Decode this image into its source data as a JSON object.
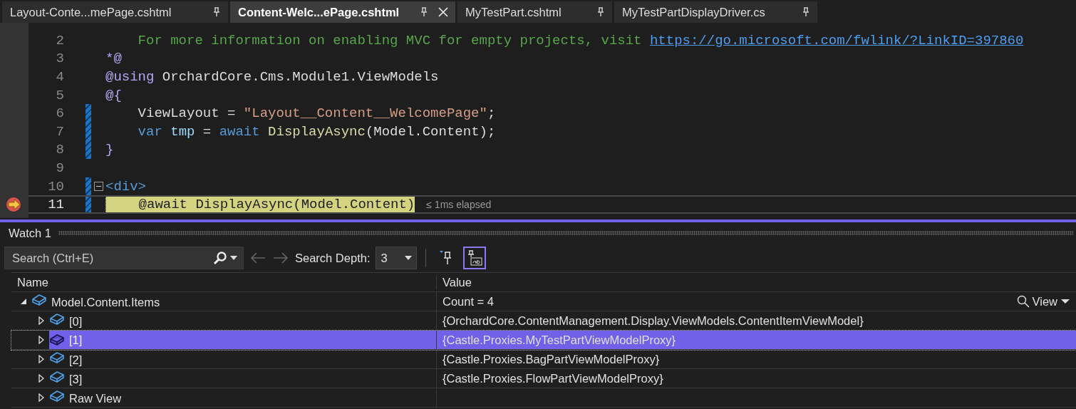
{
  "tabs": [
    {
      "label": "Layout-Conte...mePage.cshtml",
      "selected": false
    },
    {
      "label": "Content-Welc...ePage.cshtml",
      "selected": true
    },
    {
      "label": "MyTestPart.cshtml",
      "selected": false
    },
    {
      "label": "MyTestPartDisplayDriver.cs",
      "selected": false
    }
  ],
  "editor": {
    "perf_tip": "≤ 1ms elapsed",
    "lines": [
      {
        "number": "2",
        "changed": false,
        "current": false,
        "foldable": false,
        "tokens": [
          {
            "kind": "comment",
            "text": "    For more information on enabling MVC for empty projects, visit "
          },
          {
            "kind": "link",
            "text": "https://go.microsoft.com/fwlink/?LinkID=397860"
          }
        ]
      },
      {
        "number": "3",
        "changed": false,
        "current": false,
        "foldable": false,
        "tokens": [
          {
            "kind": "razor",
            "text": "*@"
          }
        ]
      },
      {
        "number": "4",
        "changed": false,
        "current": false,
        "foldable": false,
        "tokens": [
          {
            "kind": "razor",
            "text": "@using"
          },
          {
            "kind": "plain",
            "text": " OrchardCore.Cms.Module1.ViewModels"
          }
        ]
      },
      {
        "number": "5",
        "changed": false,
        "current": false,
        "foldable": false,
        "tokens": [
          {
            "kind": "razor",
            "text": "@{"
          }
        ]
      },
      {
        "number": "6",
        "changed": true,
        "current": false,
        "foldable": false,
        "tokens": [
          {
            "kind": "plain",
            "text": "    ViewLayout = "
          },
          {
            "kind": "string",
            "text": "\"Layout__Content__WelcomePage\""
          },
          {
            "kind": "plain",
            "text": ";"
          }
        ]
      },
      {
        "number": "7",
        "changed": true,
        "current": false,
        "foldable": false,
        "tokens": [
          {
            "kind": "keyword",
            "text": "    var"
          },
          {
            "kind": "variable",
            "text": " tmp"
          },
          {
            "kind": "plain",
            "text": " = "
          },
          {
            "kind": "keyword",
            "text": "await"
          },
          {
            "kind": "method",
            "text": " DisplayAsync"
          },
          {
            "kind": "plain",
            "text": "(Model.Content);"
          }
        ]
      },
      {
        "number": "8",
        "changed": true,
        "current": false,
        "foldable": false,
        "tokens": [
          {
            "kind": "razor",
            "text": "}"
          }
        ]
      },
      {
        "number": "9",
        "changed": false,
        "current": false,
        "foldable": false
      },
      {
        "number": "10",
        "changed": true,
        "current": false,
        "foldable": true,
        "tokens": [
          {
            "kind": "tag",
            "text": "<div>"
          }
        ]
      },
      {
        "number": "11",
        "changed": true,
        "current": true,
        "foldable": false,
        "tokens": [
          {
            "kind": "plain",
            "text": "    @await DisplayAsync(Model.Content)"
          }
        ]
      }
    ]
  },
  "watch": {
    "title": "Watch 1",
    "search": {
      "placeholder": "Search (Ctrl+E)"
    },
    "depth_label": "Search Depth:",
    "depth_value": "3",
    "columns": [
      "Name",
      "Value"
    ],
    "rows": [
      {
        "name": "Model.Content.Items",
        "value": "Count = 4",
        "view_button": "View",
        "expanded": true,
        "selected": false,
        "children": [
          {
            "name": "[0]",
            "value": "{OrchardCore.ContentManagement.Display.ViewModels.ContentItemViewModel}",
            "expanded": false,
            "selected": false
          },
          {
            "name": "[1]",
            "value": "{Castle.Proxies.MyTestPartViewModelProxy}",
            "expanded": false,
            "selected": true
          },
          {
            "name": "[2]",
            "value": "{Castle.Proxies.BagPartViewModelProxy}",
            "expanded": false,
            "selected": false
          },
          {
            "name": "[3]",
            "value": "{Castle.Proxies.FlowPartViewModelProxy}",
            "expanded": false,
            "selected": false
          },
          {
            "name": "Raw View",
            "expanded": false,
            "selected": false
          }
        ]
      }
    ]
  }
}
